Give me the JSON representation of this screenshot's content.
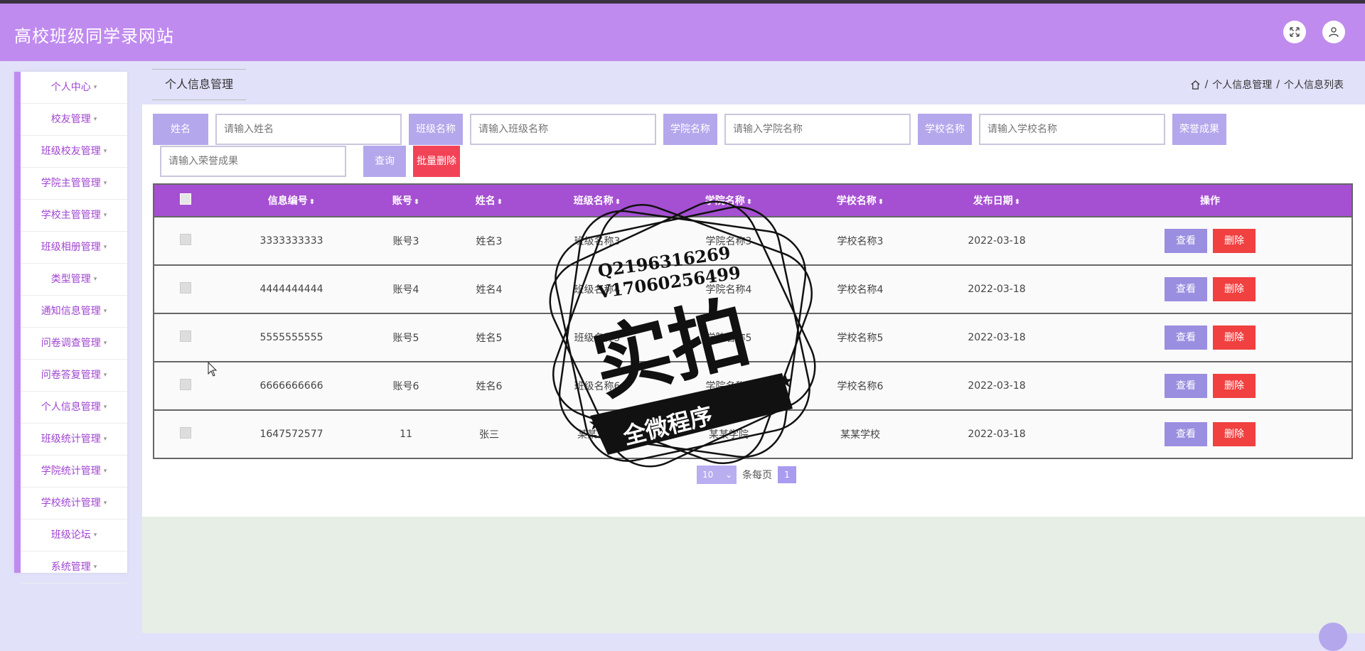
{
  "header": {
    "title": "高校班级同学录网站"
  },
  "sidebar": {
    "items": [
      {
        "label": "个人中心"
      },
      {
        "label": "校友管理"
      },
      {
        "label": "班级校友管理"
      },
      {
        "label": "学院主管管理"
      },
      {
        "label": "学校主管管理"
      },
      {
        "label": "班级相册管理"
      },
      {
        "label": "类型管理"
      },
      {
        "label": "通知信息管理"
      },
      {
        "label": "问卷调查管理"
      },
      {
        "label": "问卷答复管理"
      },
      {
        "label": "个人信息管理"
      },
      {
        "label": "班级统计管理"
      },
      {
        "label": "学院统计管理"
      },
      {
        "label": "学校统计管理"
      },
      {
        "label": "班级论坛"
      },
      {
        "label": "系统管理"
      }
    ]
  },
  "page": {
    "tab_title": "个人信息管理",
    "breadcrumb": [
      "个人信息管理",
      "个人信息列表"
    ],
    "separator": "/"
  },
  "search": {
    "name_label": "姓名",
    "name_placeholder": "请输入姓名",
    "class_label": "班级名称",
    "class_placeholder": "请输入班级名称",
    "college_label": "学院名称",
    "college_placeholder": "请输入学院名称",
    "school_label": "学校名称",
    "school_placeholder": "请输入学校名称",
    "honor_label": "荣誉成果",
    "honor_placeholder": "请输入荣誉成果",
    "query_label": "查询",
    "batch_delete_label": "批量删除"
  },
  "table": {
    "headers": [
      "信息编号",
      "账号",
      "姓名",
      "班级名称",
      "学院名称",
      "学校名称",
      "发布日期",
      "操作"
    ],
    "rows": [
      {
        "id": "3333333333",
        "account": "账号3",
        "name": "姓名3",
        "class": "班级名称3",
        "college": "学院名称3",
        "school": "学校名称3",
        "date": "2022-03-18"
      },
      {
        "id": "4444444444",
        "account": "账号4",
        "name": "姓名4",
        "class": "班级名称4",
        "college": "学院名称4",
        "school": "学校名称4",
        "date": "2022-03-18"
      },
      {
        "id": "5555555555",
        "account": "账号5",
        "name": "姓名5",
        "class": "班级名称5",
        "college": "学院名称5",
        "school": "学校名称5",
        "date": "2022-03-18"
      },
      {
        "id": "6666666666",
        "account": "账号6",
        "name": "姓名6",
        "class": "班级名称6",
        "college": "学院名称6",
        "school": "学校名称6",
        "date": "2022-03-18"
      },
      {
        "id": "1647572577",
        "account": "11",
        "name": "张三",
        "class": "某某班级",
        "college": "某某学院",
        "school": "某某学校",
        "date": "2022-03-18"
      }
    ],
    "view_label": "查看",
    "delete_label": "删除"
  },
  "pagination": {
    "page_size": "10",
    "per_page_text": "条每页",
    "current_page": "1"
  },
  "watermark": {
    "line1": "Q2196316269",
    "line2": "V17060256499",
    "big_text": "实拍",
    "ribbon_text": "全微程序"
  },
  "colors": {
    "header": "#c08bef",
    "accent": "#a54fd2",
    "button": "#b4a7ec",
    "danger": "#f24356"
  }
}
